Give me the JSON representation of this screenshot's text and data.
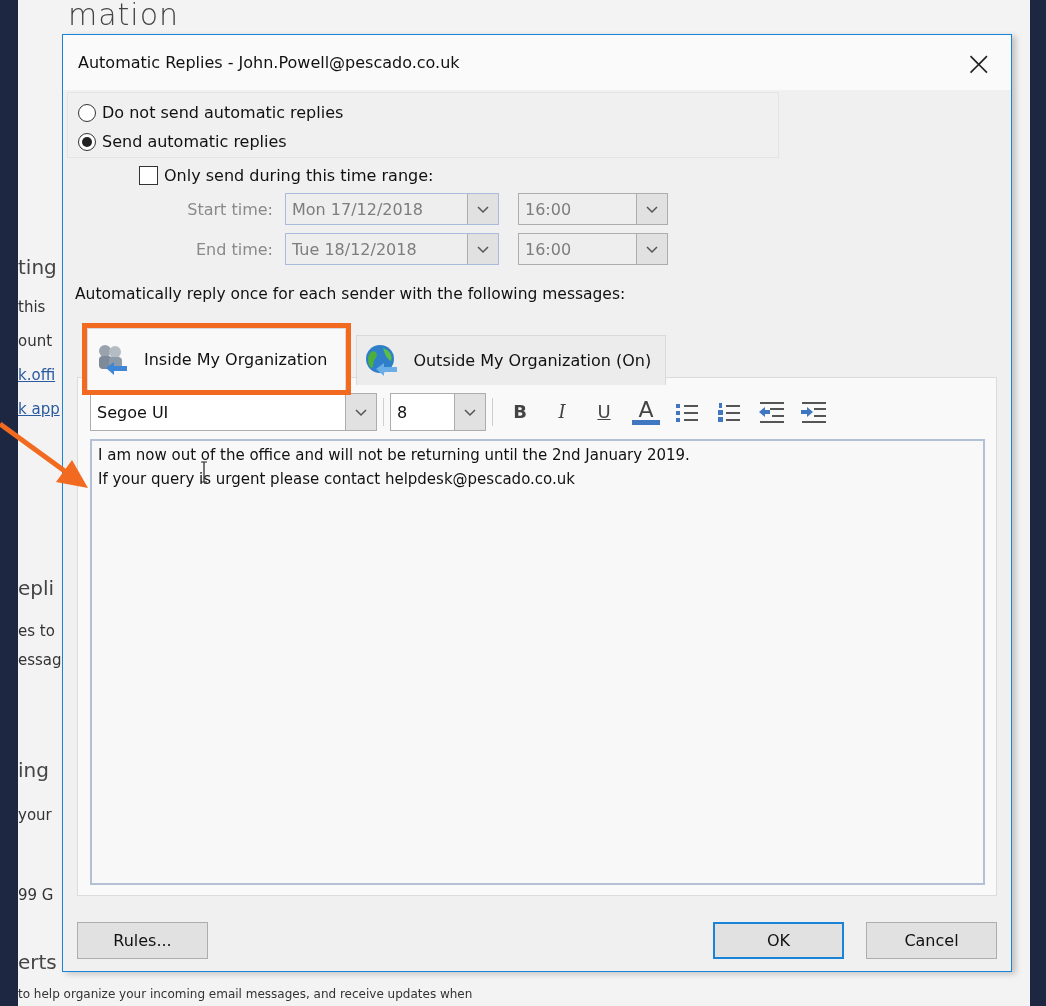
{
  "background_page": {
    "title": "mation",
    "fragments": [
      {
        "kind": "heading",
        "text": "ting"
      },
      {
        "kind": "text",
        "text": "this"
      },
      {
        "kind": "text",
        "text": "ount"
      },
      {
        "kind": "link",
        "text": "k.offi"
      },
      {
        "kind": "link",
        "text": "k app"
      },
      {
        "kind": "heading",
        "text": "epli"
      },
      {
        "kind": "text",
        "text": "es to"
      },
      {
        "kind": "text",
        "text": "essag"
      },
      {
        "kind": "heading",
        "text": "ing"
      },
      {
        "kind": "text",
        "text": "your"
      },
      {
        "kind": "text",
        "text": "99 G"
      },
      {
        "kind": "heading",
        "text": "erts"
      },
      {
        "kind": "text",
        "text": "to help organize your incoming email messages, and receive updates when"
      }
    ]
  },
  "dialog": {
    "title": "Automatic Replies - John.Powell@pescado.co.uk",
    "close": "×",
    "reply_options": [
      {
        "label": "Do not send automatic replies",
        "selected": false
      },
      {
        "label": "Send automatic replies",
        "selected": true
      }
    ],
    "time_range": {
      "label": "Only send during this time range:",
      "checked": false,
      "disabled": true,
      "rows": [
        {
          "label": "Start time:",
          "date": "Mon 17/12/2018",
          "time": "16:00"
        },
        {
          "label": "End time:",
          "date": "Tue 18/12/2018",
          "time": "16:00"
        }
      ]
    },
    "instruction": "Automatically reply once for each sender with the following messages:",
    "tabs": [
      {
        "label": "Inside My Organization",
        "kind": "people",
        "selected": true,
        "highlighted": true
      },
      {
        "label": "Outside My Organization (On)",
        "kind": "globe",
        "selected": false,
        "highlighted": false
      }
    ],
    "toolbar": {
      "font": "Segoe UI",
      "size": "8",
      "tools": [
        {
          "kind": "bold",
          "label": "B"
        },
        {
          "kind": "italic",
          "label": "I"
        },
        {
          "kind": "underline",
          "label": "U"
        },
        {
          "kind": "font-color",
          "label": "A"
        },
        {
          "kind": "bullets"
        },
        {
          "kind": "numbering"
        },
        {
          "kind": "outdent"
        },
        {
          "kind": "indent"
        }
      ]
    },
    "message": "I am now out of the office and will not be returning until the 2nd January 2019.\nIf your query is urgent please contact helpdesk@pescado.co.uk",
    "buttons": [
      {
        "label": "Rules...",
        "kind": "normal"
      },
      {
        "label": "OK",
        "kind": "default"
      },
      {
        "label": "Cancel",
        "kind": "normal"
      }
    ]
  }
}
